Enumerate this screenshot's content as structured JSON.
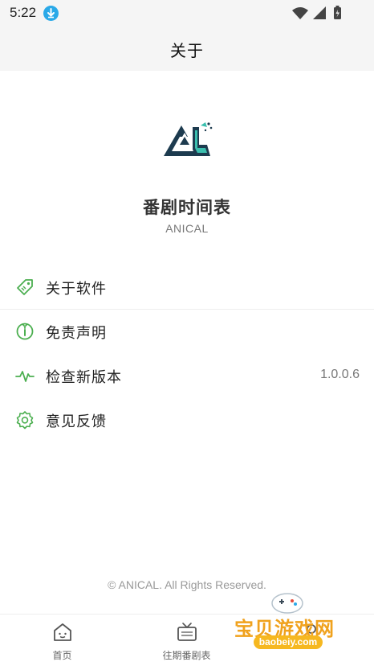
{
  "status_bar": {
    "time": "5:22"
  },
  "app_bar": {
    "title": "关于"
  },
  "about": {
    "app_name": "番剧时间表",
    "app_subtitle": "ANICAL"
  },
  "menu": {
    "items": [
      {
        "label": "关于软件",
        "icon": "tag-icon"
      },
      {
        "label": "免责声明",
        "icon": "info-badge-icon"
      },
      {
        "label": "检查新版本",
        "icon": "pulse-icon",
        "value": "1.0.0.6"
      },
      {
        "label": "意见反馈",
        "icon": "settings-gear-icon"
      }
    ]
  },
  "footer": {
    "copyright": "© ANICAL. All Rights Reserved."
  },
  "bottom_nav": {
    "items": [
      {
        "label": "首页",
        "icon": "home-icon"
      },
      {
        "label": "往期番剧表",
        "icon": "tv-icon"
      }
    ]
  },
  "watermark": {
    "text": "宝贝游戏网",
    "url": "baobeiy.com"
  },
  "colors": {
    "accent": "#4caf50",
    "logo_dark": "#1d3b4f",
    "logo_teal": "#3bbfae"
  }
}
